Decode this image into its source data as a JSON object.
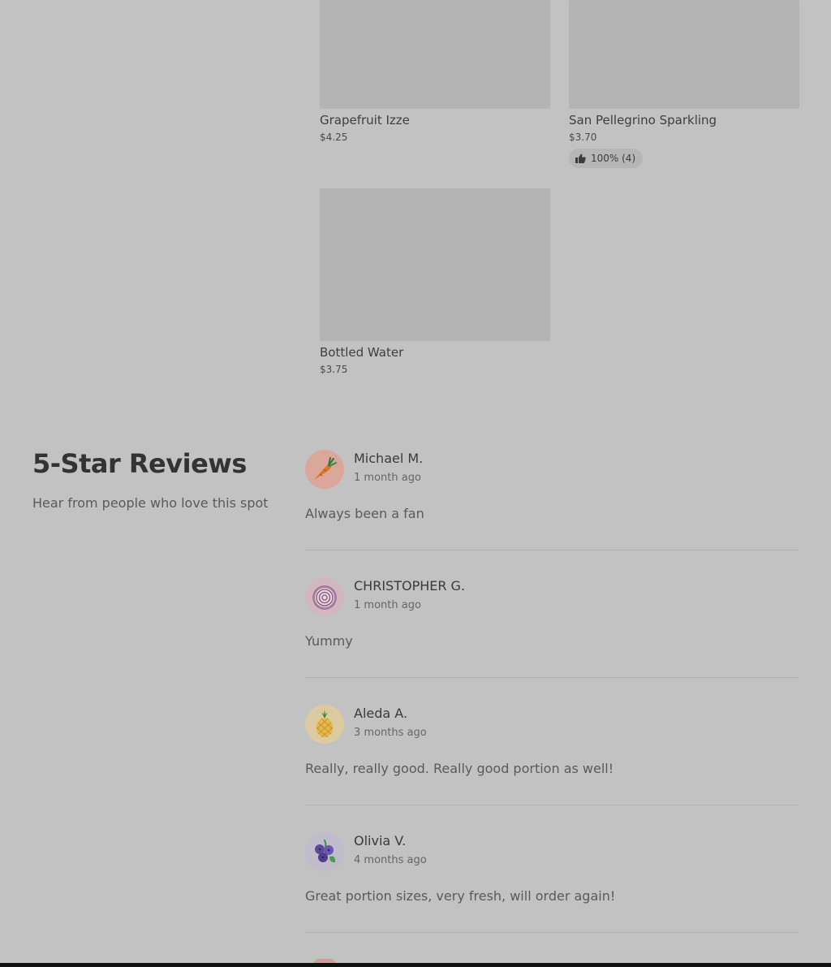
{
  "products": [
    {
      "name": "Grapefruit Izze",
      "price": "$4.25"
    },
    {
      "name": "San Pellegrino Sparkling",
      "price": "$3.70",
      "rating": "100% (4)"
    },
    {
      "name": "Bottled Water",
      "price": "$3.75"
    }
  ],
  "reviews_section": {
    "title": "5-Star Reviews",
    "subtitle": "Hear from people who love this spot",
    "items": [
      {
        "name": "Michael M.",
        "time": "1 month ago",
        "text": "Always been a fan",
        "avatar_icon": "carrot-icon",
        "avatar_bg": "#dba79b"
      },
      {
        "name": "CHRISTOPHER G.",
        "time": "1 month ago",
        "text": "Yummy",
        "avatar_icon": "onion-icon",
        "avatar_bg": "#d2b6c0"
      },
      {
        "name": "Aleda A.",
        "time": "3 months ago",
        "text": "Really, really good. Really good portion as well!",
        "avatar_icon": "pineapple-icon",
        "avatar_bg": "#dccaa0"
      },
      {
        "name": "Olivia V.",
        "time": "4 months ago",
        "text": "Great portion sizes, very fresh, will order again!",
        "avatar_icon": "blueberry-icon",
        "avatar_bg": "#c1bccc"
      }
    ]
  },
  "colors": {
    "page_bg": "#c2c2c2",
    "image_placeholder": "#b4b4b4",
    "divider": "#b3b3b3"
  }
}
